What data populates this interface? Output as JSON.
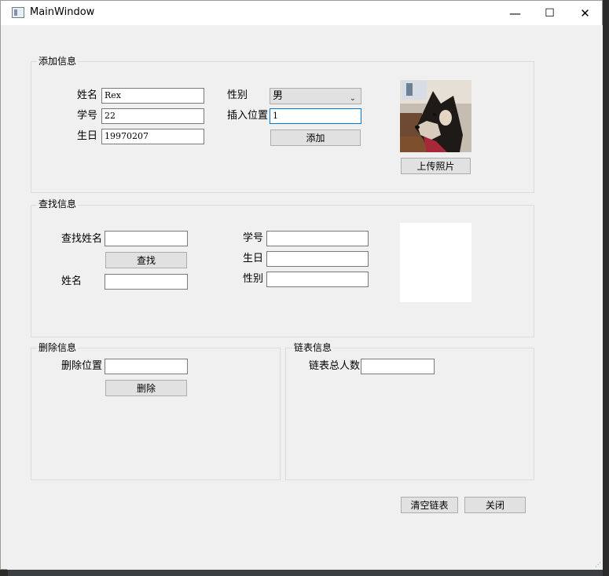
{
  "window": {
    "title": "MainWindow",
    "minimize": "—",
    "maximize": "☐",
    "close": "✕"
  },
  "add": {
    "group_title": "添加信息",
    "name_label": "姓名",
    "name_value": "Rex",
    "id_label": "学号",
    "id_value": "22",
    "birthday_label": "生日",
    "birthday_value": "19970207",
    "gender_label": "性别",
    "gender_value": "男",
    "position_label": "插入位置",
    "position_value": "1",
    "add_button": "添加",
    "upload_button": "上传照片"
  },
  "search": {
    "group_title": "查找信息",
    "search_name_label": "查找姓名",
    "search_button": "查找",
    "name_label": "姓名",
    "id_label": "学号",
    "birthday_label": "生日",
    "gender_label": "性别"
  },
  "delete": {
    "group_title": "删除信息",
    "position_label": "删除位置",
    "delete_button": "删除"
  },
  "list_info": {
    "group_title": "链表信息",
    "total_label": "链表总人数"
  },
  "footer": {
    "clear_button": "清空链表",
    "close_button": "关闭"
  },
  "icons": {
    "app": "window-app-icon",
    "select_arrow": "chevron-down-icon"
  },
  "colors": {
    "focus_border": "#0078d7",
    "window_bg": "#f0f0f0"
  }
}
